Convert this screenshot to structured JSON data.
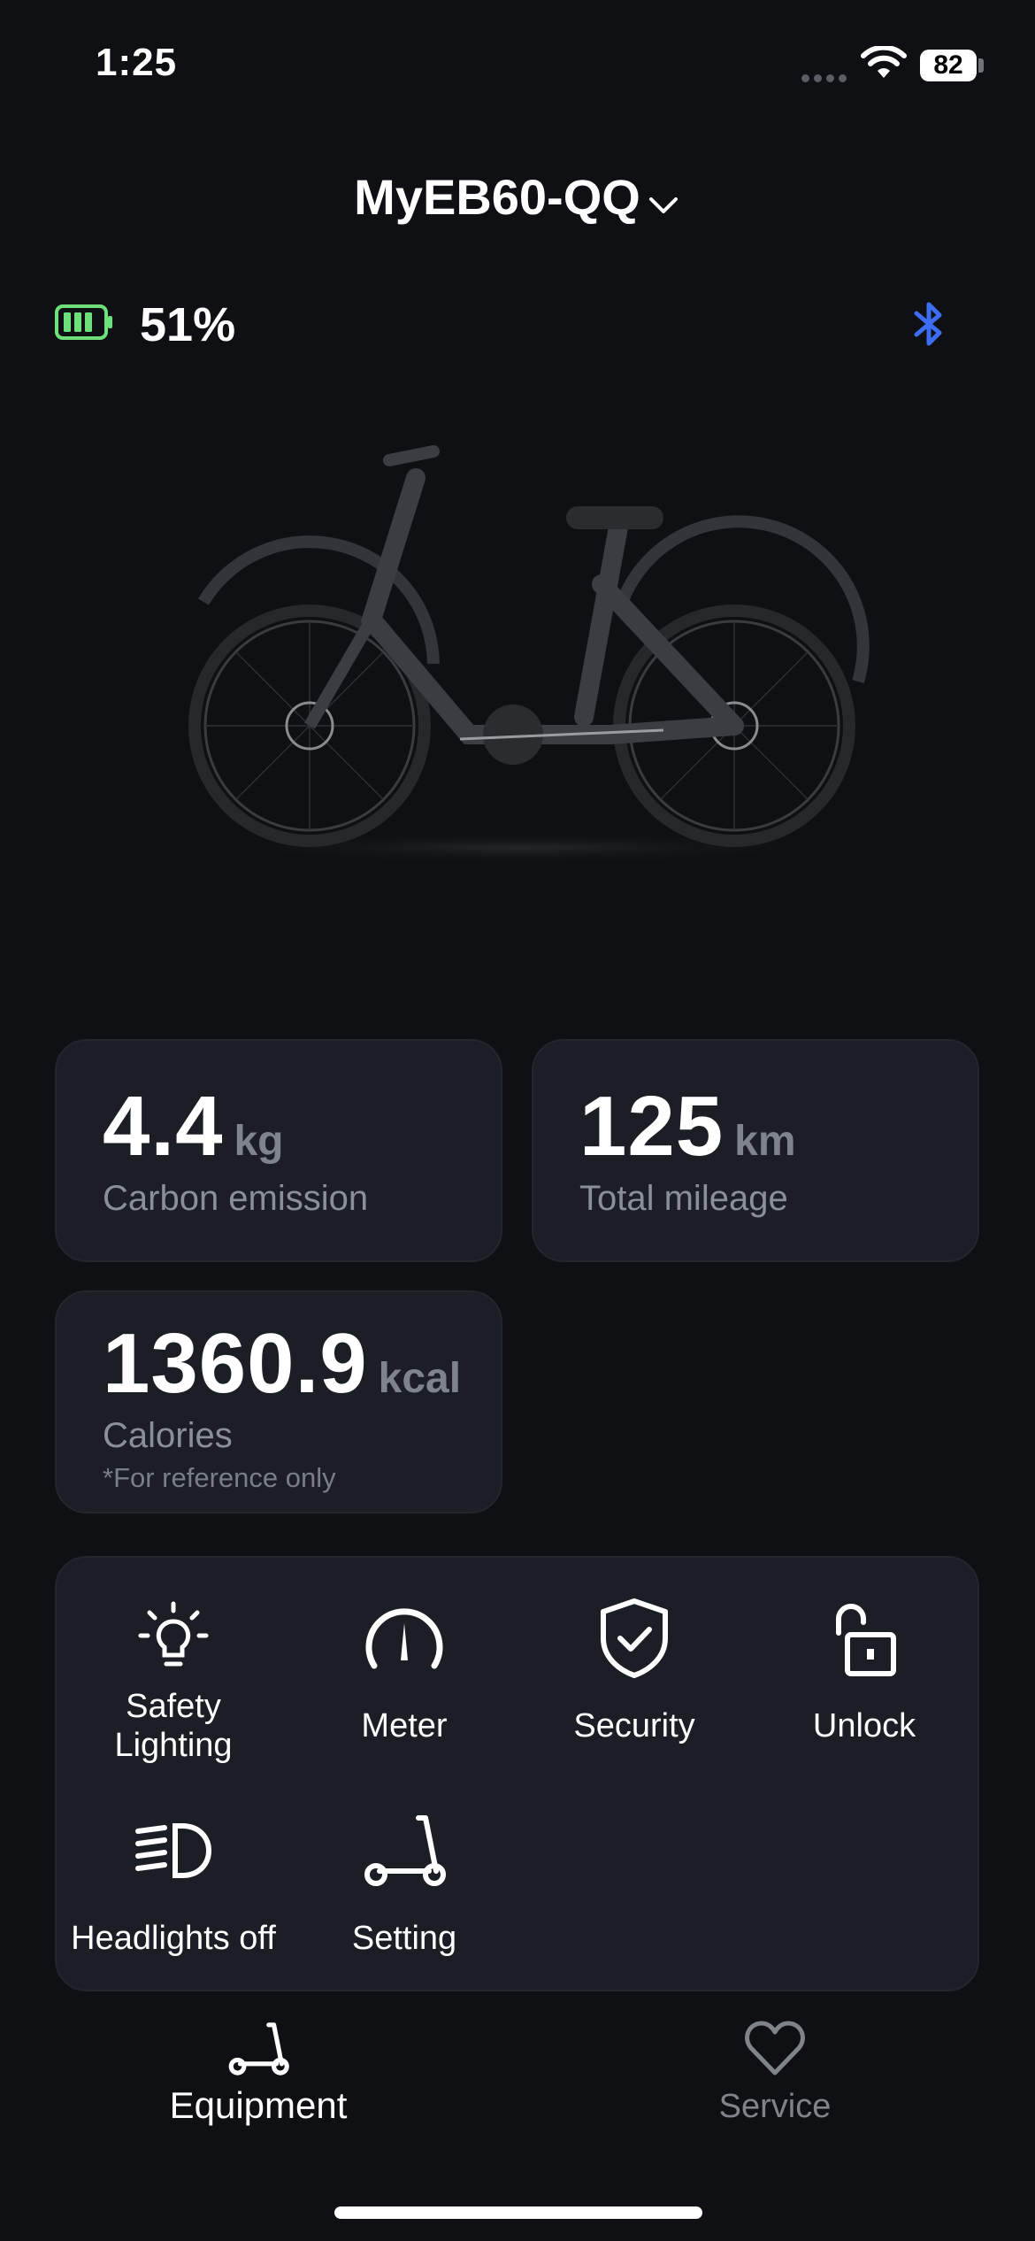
{
  "status_bar": {
    "time": "1:25",
    "battery": "82"
  },
  "header": {
    "device_name": "MyEB60-QQ"
  },
  "battery": {
    "percent": "51%",
    "color": "#6ee07a"
  },
  "bluetooth": {
    "color": "#3d6df2"
  },
  "stats": {
    "carbon": {
      "value": "4.4",
      "unit": "kg",
      "label": "Carbon emission"
    },
    "mileage": {
      "value": "125",
      "unit": "km",
      "label": "Total mileage"
    },
    "calories": {
      "value": "1360.9",
      "unit": "kcal",
      "label": "Calories",
      "note": "*For reference only"
    }
  },
  "controls": [
    {
      "label": "Safety\nLighting",
      "icon": "bulb-icon"
    },
    {
      "label": "Meter",
      "icon": "gauge-icon"
    },
    {
      "label": "Security",
      "icon": "shield-check-icon"
    },
    {
      "label": "Unlock",
      "icon": "unlock-icon"
    },
    {
      "label": "Headlights off",
      "icon": "headlight-icon"
    },
    {
      "label": "Setting",
      "icon": "scooter-icon"
    }
  ],
  "tabs": [
    {
      "label": "Equipment",
      "active": true,
      "icon": "scooter-icon"
    },
    {
      "label": "Service",
      "active": false,
      "icon": "heart-icon"
    }
  ],
  "colors": {
    "background": "#0e1014",
    "card": "#1b1e24",
    "muted": "#7f838a"
  }
}
